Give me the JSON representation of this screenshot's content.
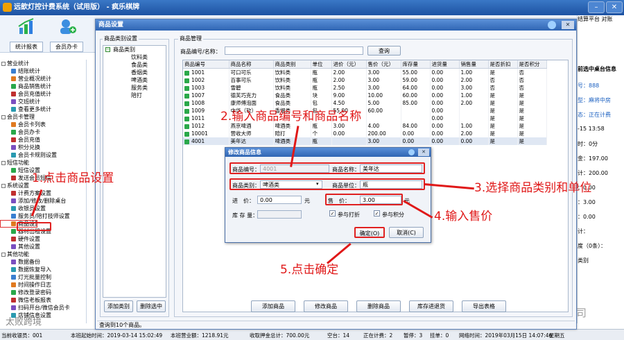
{
  "app": {
    "title": "远歆灯控计费系统（试用版） - 疯乐棋牌"
  },
  "toolbar": {
    "stats_label": "统计报表",
    "member_label": "会员办卡"
  },
  "sidebar": [
    {
      "header": "营业统计",
      "items": [
        "结账统计",
        "营业概况统计",
        "商品销售统计",
        "会员充值统计",
        "交班统计",
        "查看更多统计"
      ]
    },
    {
      "header": "会员卡管理",
      "items": [
        "会员卡列表",
        "会员办卡",
        "会员充值",
        "积分兑换",
        "会员卡规则设置"
      ]
    },
    {
      "header": "短信功能",
      "items": [
        "短信设置",
        "发送会员短信"
      ]
    },
    {
      "header": "系统设置",
      "items": [
        "计费方案设置",
        "添加/修改/删除桌台",
        "收银员设置",
        "服务员/陪打技师设置",
        "商品设置",
        "器材出租设置",
        "硬件设置",
        "其他设置"
      ]
    },
    {
      "header": "其他功能",
      "items": [
        "数据备份",
        "数据恢复导入",
        "灯光批量控制",
        "时间操作日志",
        "修改登录密码",
        "微信老板报表",
        "扫码开台/微信会员卡",
        "店铺信息设置"
      ]
    }
  ],
  "right_panel": {
    "peek": "结算平台 对账",
    "title": "前选中桌台信息",
    "rows": [
      "号：888",
      "型：麻将中房",
      "态：正在计费",
      "-15 13:58",
      "时：0分",
      "金：197.00",
      "计：200.00",
      "：0.00",
      "：3.00",
      "：0.00",
      "计：",
      "度（0条）：",
      "类别"
    ]
  },
  "dialog": {
    "title": "商品设置",
    "category_group": "商品类别设置",
    "tree_root": "商品类别",
    "categories": [
      "饮料类",
      "食品类",
      "香烟类",
      "啤酒类",
      "服务类",
      "陪打"
    ],
    "product_group": "商品管理",
    "search_label": "商品编号/名称：",
    "search_button": "查询",
    "add_category": "添加类别",
    "delete_category": "删除选中",
    "columns": [
      "商品编号",
      "商品名称",
      "商品类别",
      "单位",
      "进价（元）",
      "售价（元）",
      "库存量",
      "进货量",
      "销售量",
      "是否折扣",
      "是否积分"
    ],
    "rows": [
      [
        "1001",
        "可口可乐",
        "饮料类",
        "瓶",
        "2.00",
        "3.00",
        "55.00",
        "0.00",
        "1.00",
        "是",
        "否"
      ],
      [
        "1002",
        "百事可乐",
        "饮料类",
        "瓶",
        "2.00",
        "3.00",
        "59.00",
        "0.00",
        "2.00",
        "否",
        "否"
      ],
      [
        "1003",
        "雪碧",
        "饮料类",
        "瓶",
        "2.50",
        "3.00",
        "64.00",
        "0.00",
        "3.00",
        "否",
        "否"
      ],
      [
        "1007",
        "德芙巧克力",
        "食品类",
        "块",
        "9.00",
        "10.00",
        "60.00",
        "0.00",
        "1.00",
        "是",
        "是"
      ],
      [
        "1008",
        "康师傅泡面",
        "食品类",
        "包",
        "4.50",
        "5.00",
        "85.00",
        "0.00",
        "2.00",
        "是",
        "是"
      ],
      [
        "1009",
        "中华（软）",
        "香烟类",
        "包",
        "55.00",
        "60.00",
        "",
        "0.00",
        "",
        "是",
        "是"
      ],
      [
        "1011",
        "",
        "",
        "",
        "",
        "",
        "",
        "0.00",
        "",
        "是",
        "是"
      ],
      [
        "1012",
        "燕京啤酒",
        "啤酒类",
        "瓶",
        "3.00",
        "4.00",
        "84.00",
        "0.00",
        "1.00",
        "是",
        "是"
      ],
      [
        "10001",
        "营收大师",
        "陪打",
        "个",
        "0.00",
        "200.00",
        "0.00",
        "0.00",
        "2.00",
        "是",
        "是"
      ],
      [
        "4001",
        "美年达",
        "啤酒类",
        "瓶",
        "",
        "3.00",
        "0.00",
        "0.00",
        "0.00",
        "是",
        "是"
      ]
    ],
    "buttons": [
      "添加商品",
      "修改商品",
      "删除商品",
      "库存进退货",
      "导出表格"
    ],
    "status": "查询到10个商品。"
  },
  "edit": {
    "title": "修改商品信息",
    "code_label": "商品编号：",
    "code_value": "4001",
    "name_label": "商品名称：",
    "name_value": "美年达",
    "cat_label": "商品类别：",
    "cat_value": "啤酒类",
    "unit_label": "商品单位：",
    "unit_value": "瓶",
    "cost_label": "进　价：",
    "cost_value": "0.00",
    "cost_unit": "元",
    "price_label": "售　价：",
    "price_value": "3.00",
    "price_unit": "元",
    "stock_label": "库 存 量：",
    "discount_label": "参与打折",
    "points_label": "参与积分",
    "ok": "确定(O)",
    "cancel": "取消(C)"
  },
  "annotations": {
    "a1": "1.点击商品设置",
    "a2": "2.输入商品编号和商品名称",
    "a3": "3.选择商品类别和单位",
    "a4": "4.输入售价",
    "a5": "5.点击确定"
  },
  "status_bar": [
    "当前收银员：001",
    "本班起始时间：2019-03-14 15:02:49",
    "本班营业额：1218.91元",
    "收取押金总计：700.00元",
    "空台：14",
    "正在计费：2",
    "暂停：3",
    "挂单：0",
    "网络时间：2019年03月15日 14:07:46",
    "星期五"
  ],
  "watermarks": {
    "left": "太败跨境",
    "right": "远歆公司"
  },
  "colors": {
    "title_blue": "#2f65b3",
    "annotation_red": "#e01818",
    "check_green": "#2aa84a"
  }
}
